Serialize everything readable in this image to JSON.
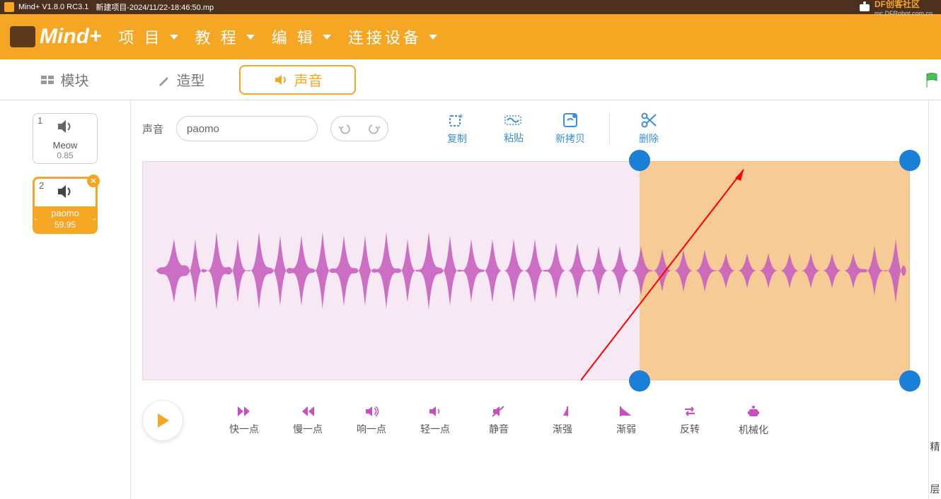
{
  "title": {
    "app": "Mind+ V1.8.0 RC3.1",
    "project": "新建项目-2024/11/22-18:46:50.mp"
  },
  "community": {
    "label": "DF创客社区",
    "url": "mc.DFRobot.com.cn"
  },
  "menu": {
    "project": "项 目",
    "tutorial": "教 程",
    "edit": "编 辑",
    "connect": "连接设备"
  },
  "tabs": {
    "blocks": "模块",
    "costumes": "造型",
    "sounds": "声音"
  },
  "sounds": [
    {
      "idx": "1",
      "name": "Meow",
      "dur": "0.85"
    },
    {
      "idx": "2",
      "name": "paomo",
      "dur": "59.95"
    }
  ],
  "editor": {
    "label": "声音",
    "name": "paomo"
  },
  "tools": {
    "copy": "复制",
    "paste": "粘贴",
    "copynew": "新拷贝",
    "delete": "删除"
  },
  "fx": {
    "faster": "快一点",
    "slower": "慢一点",
    "louder": "响一点",
    "softer": "轻一点",
    "mute": "静音",
    "fadein": "渐强",
    "fadeout": "渐弱",
    "reverse": "反转",
    "robot": "机械化"
  },
  "right": {
    "a": "精",
    "b": "层"
  }
}
